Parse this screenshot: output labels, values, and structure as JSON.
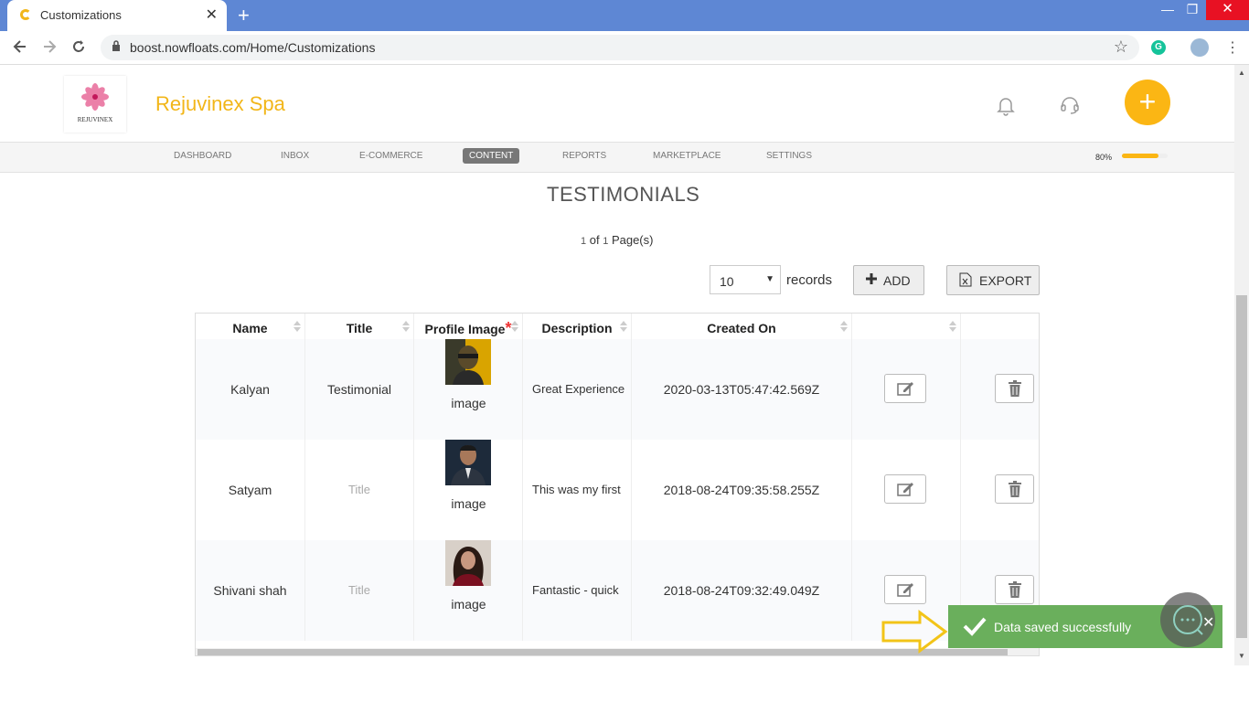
{
  "browser": {
    "tab_title": "Customizations",
    "url": "boost.nowfloats.com/Home/Customizations",
    "tab_close": "✕",
    "new_tab": "+",
    "minimize": "—",
    "restore": "❐",
    "close": "✕"
  },
  "header": {
    "logo_text": "REJUVINEX",
    "brand": "Rejuvinex Spa",
    "fab_label": "+"
  },
  "nav": {
    "items": [
      "DASHBOARD",
      "INBOX",
      "E-COMMERCE",
      "CONTENT",
      "REPORTS",
      "MARKETPLACE",
      "SETTINGS"
    ],
    "active": "CONTENT",
    "progress_label": "80%",
    "progress_value": 0.8
  },
  "page": {
    "title": "TESTIMONIALS",
    "pager": {
      "current": "1",
      "of": " of ",
      "total": "1",
      "suffix": " Page(s)"
    },
    "records_select": "10",
    "records_label": "records",
    "add_label": "ADD",
    "export_label": "EXPORT"
  },
  "table": {
    "columns": [
      "Name",
      "Title",
      "Profile Image",
      "Description",
      "Created On"
    ],
    "required_mark": "*",
    "rows": [
      {
        "name": "Kalyan",
        "title": "Testimonial",
        "image_label": "image",
        "description": "Great Experience",
        "created_on": "2020-03-13T05:47:42.569Z"
      },
      {
        "name": "Satyam",
        "title": "Title",
        "image_label": "image",
        "description": "This was my first",
        "created_on": "2018-08-24T09:35:58.255Z"
      },
      {
        "name": "Shivani shah",
        "title": "Title",
        "image_label": "image",
        "description": "Fantastic - quick",
        "created_on": "2018-08-24T09:32:49.049Z"
      }
    ]
  },
  "toast": {
    "message": "Data saved successfully",
    "close": "✕"
  },
  "colors": {
    "brand": "#f2b619",
    "fab": "#fbb614",
    "toast": "#6aaf5c",
    "chrome_tabbar": "#5e87d4"
  }
}
